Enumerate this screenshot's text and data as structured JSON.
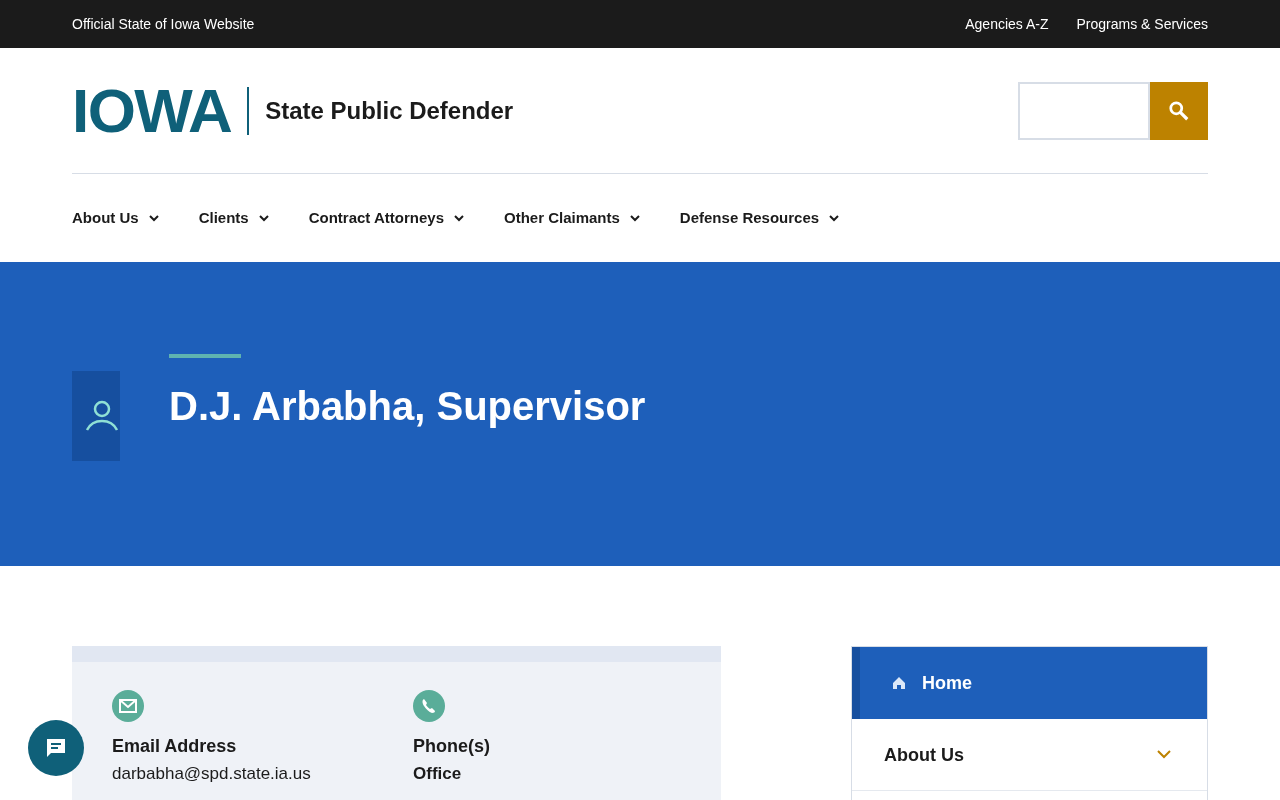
{
  "top_bar": {
    "label": "Official State of Iowa Website",
    "links": [
      "Agencies A-Z",
      "Programs & Services"
    ]
  },
  "header": {
    "logo_text": "IOWA",
    "site_title": "State Public Defender"
  },
  "nav": [
    "About Us",
    "Clients",
    "Contract Attorneys",
    "Other Claimants",
    "Defense Resources"
  ],
  "hero": {
    "title": "D.J. Arbabha, Supervisor"
  },
  "contact": [
    {
      "kind": "email",
      "heading": "Email Address",
      "value": "darbabha@spd.state.ia.us"
    },
    {
      "kind": "phone",
      "heading": "Phone(s)",
      "value": "Office"
    }
  ],
  "sidebar": {
    "items": [
      {
        "label": "Home",
        "selected": true,
        "kind": "home"
      },
      {
        "label": "About Us",
        "selected": false,
        "kind": "expand"
      }
    ]
  }
}
